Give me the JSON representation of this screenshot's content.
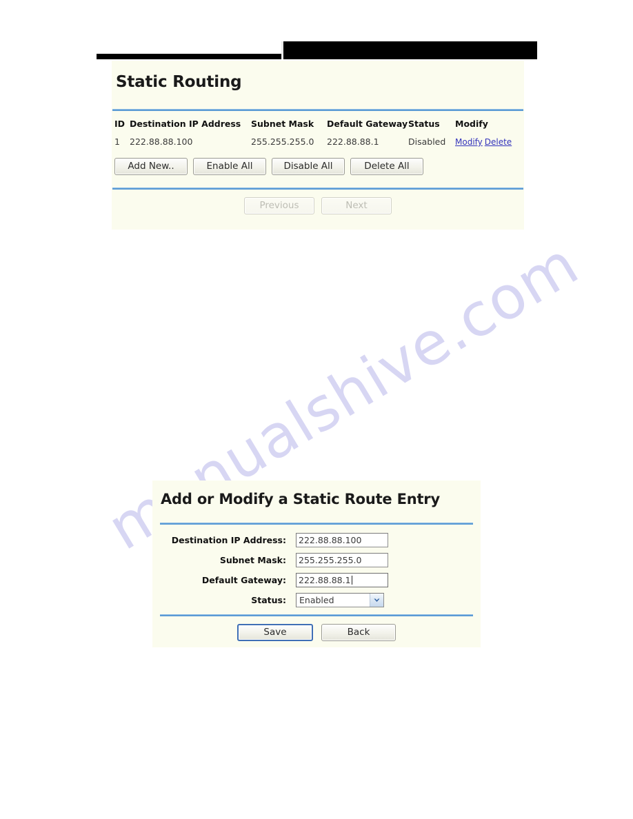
{
  "watermark": {
    "text": "manualshive.com"
  },
  "routing_panel": {
    "title": "Static Routing",
    "table": {
      "columns": [
        "ID",
        "Destination IP Address",
        "Subnet Mask",
        "Default Gateway",
        "Status",
        "Modify"
      ],
      "rows": [
        {
          "id": "1",
          "destination_ip": "222.88.88.100",
          "subnet_mask": "255.255.255.0",
          "default_gateway": "222.88.88.1",
          "status": "Disabled",
          "modify_link": "Modify",
          "delete_link": "Delete"
        }
      ]
    },
    "actions": {
      "add_new": "Add New..",
      "enable_all": "Enable All",
      "disable_all": "Disable All",
      "delete_all": "Delete All"
    },
    "pager": {
      "previous": "Previous",
      "next": "Next"
    }
  },
  "entry_panel": {
    "title": "Add or Modify a Static Route Entry",
    "fields": {
      "destination_ip": {
        "label": "Destination IP Address:",
        "value": "222.88.88.100"
      },
      "subnet_mask": {
        "label": "Subnet Mask:",
        "value": "255.255.255.0"
      },
      "default_gateway": {
        "label": "Default Gateway:",
        "value": "222.88.88.1"
      },
      "status": {
        "label": "Status:",
        "value": "Enabled"
      }
    },
    "buttons": {
      "save": "Save",
      "back": "Back"
    }
  },
  "colors": {
    "panel_background": "#fbfcee",
    "separator": "#5b9bd5",
    "link": "#3333bb",
    "watermark": "#c9c7ef",
    "focus_border": "#3f6fb5"
  }
}
